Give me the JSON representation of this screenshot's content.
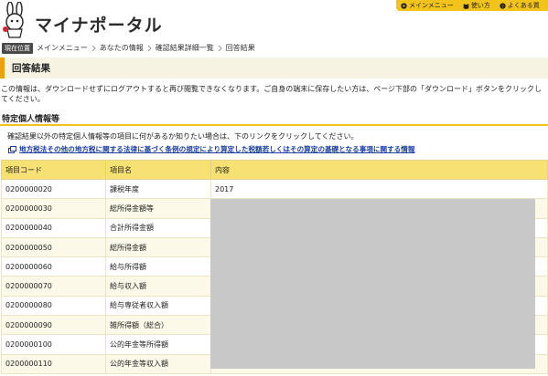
{
  "header": {
    "brand": "マイナポータル",
    "topmenu": [
      {
        "icon": "menu-dot-icon",
        "label": "メインメニュー"
      },
      {
        "icon": "book-icon",
        "label": "使い方"
      },
      {
        "icon": "question-icon",
        "label": "よくある質"
      }
    ]
  },
  "breadcrumb": {
    "label": "現在位置",
    "items": [
      "メインメニュー",
      "あなたの情報",
      "確認結果詳細一覧",
      "回答結果"
    ]
  },
  "page": {
    "title": "回答結果",
    "notice": "この情報は、ダウンロードせずにログアウトすると再び閲覧できなくなります。ご自身の端末に保存したい方は、ページ下部の「ダウンロード」ボタンをクリックしてください。"
  },
  "section": {
    "title": "特定個人情報等",
    "description": "確認結果以外の特定個人情報等の項目に何があるか知りたい場合は、下のリンクをクリックしてください。",
    "link": "地方税法その他の地方税に関する法律に基づく条例の規定により算定した税額若しくはその算定の基礎となる事項に関する情報"
  },
  "table": {
    "headers": [
      "項目コード",
      "項目名",
      "内容"
    ],
    "rows": [
      {
        "code": "0200000020",
        "name": "課税年度",
        "value": "2017"
      },
      {
        "code": "0200000030",
        "name": "総所得金額等",
        "value": ""
      },
      {
        "code": "0200000040",
        "name": "合計所得金額",
        "value": ""
      },
      {
        "code": "0200000050",
        "name": "総所得金額",
        "value": ""
      },
      {
        "code": "0200000060",
        "name": "給与所得額",
        "value": ""
      },
      {
        "code": "0200000070",
        "name": "給与収入額",
        "value": ""
      },
      {
        "code": "0200000080",
        "name": "給与専従者収入額",
        "value": ""
      },
      {
        "code": "0200000090",
        "name": "雑所得額（総合）",
        "value": ""
      },
      {
        "code": "0200000100",
        "name": "公的年金等所得額",
        "value": ""
      },
      {
        "code": "0200000110",
        "name": "公的年金等収入額",
        "value": ""
      }
    ]
  },
  "colors": {
    "accent": "#f2c41a",
    "title_bar": "#f6f3e2",
    "title_marker": "#e8a30f",
    "link": "#1b3f9e"
  }
}
